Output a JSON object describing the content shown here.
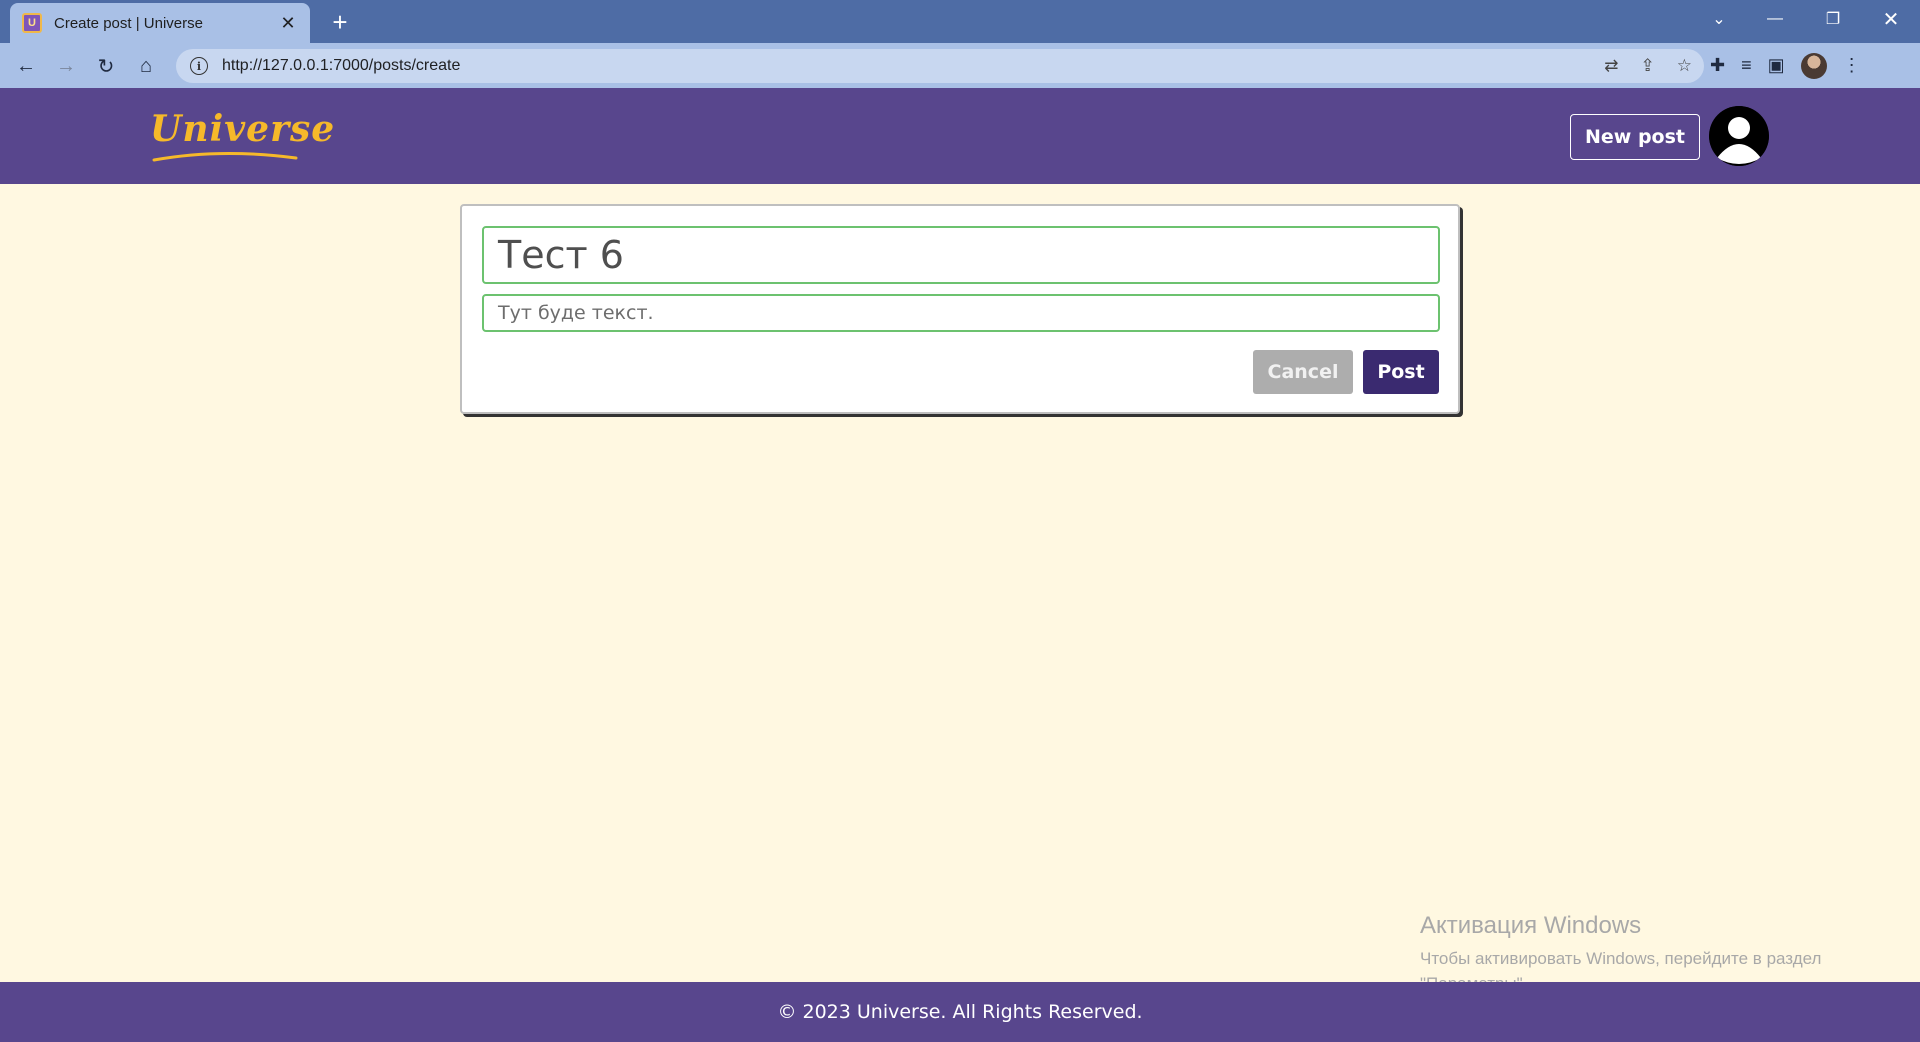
{
  "browser": {
    "tab_title": "Create post | Universe",
    "tab_favicon_letter": "U",
    "url": "http://127.0.0.1:7000/posts/create"
  },
  "header": {
    "logo_text": "Universe",
    "new_post_label": "New post"
  },
  "form": {
    "title_value": "Тест 6",
    "body_value": "Тут буде текст.",
    "cancel_label": "Cancel",
    "post_label": "Post"
  },
  "watermark": {
    "title": "Активация Windows",
    "line1": "Чтобы активировать Windows, перейдите в раздел",
    "line2": "\"Параметры\"."
  },
  "footer": {
    "text": "© 2023 Universe. All Rights Reserved."
  },
  "colors": {
    "header_bg": "#58468d",
    "page_bg": "#fff8e1",
    "logo": "#f6b92a",
    "input_border": "#6cc26f",
    "post_button": "#3a2a70",
    "cancel_button": "#adadad"
  }
}
